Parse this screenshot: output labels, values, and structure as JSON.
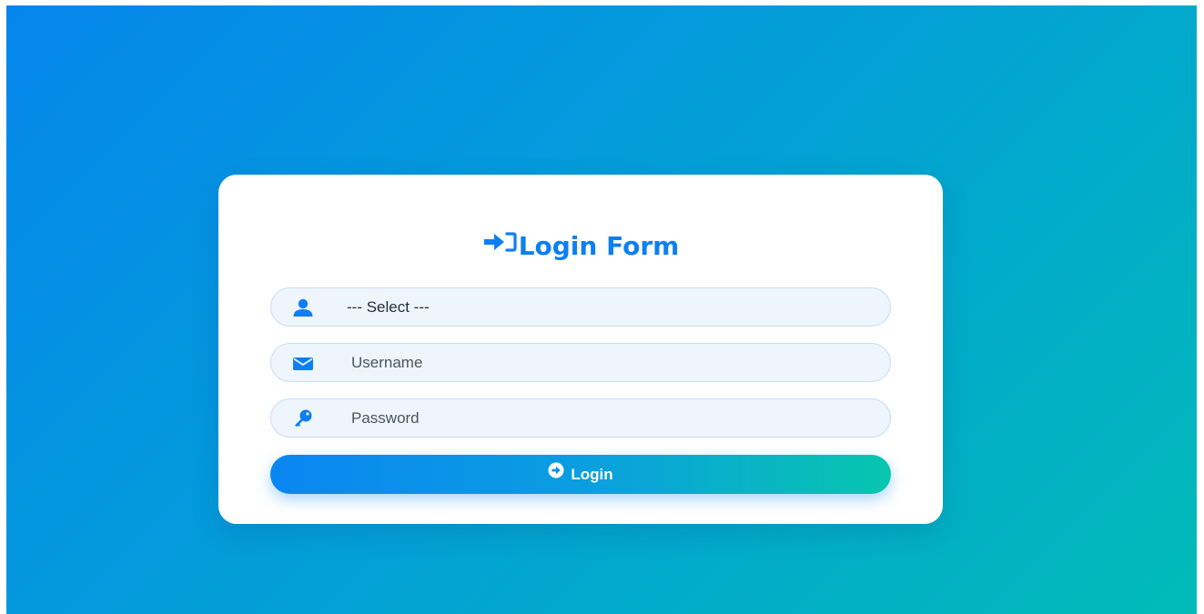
{
  "form": {
    "title": "Login Form",
    "role_select": {
      "selected": "--- Select ---",
      "icon": "user-icon"
    },
    "username": {
      "placeholder": "Username",
      "value": "",
      "icon": "envelope-icon"
    },
    "password": {
      "placeholder": "Password",
      "value": "",
      "icon": "key-icon"
    },
    "submit": {
      "label": "Login",
      "icon": "arrow-circle-right-icon"
    }
  },
  "colors": {
    "background_start": "#0586ec",
    "background_end": "#02bbb8",
    "accent": "#0e7ff0",
    "button_start": "#0a86f2",
    "button_end": "#07c6ae",
    "field_background": "#eef5fd"
  }
}
